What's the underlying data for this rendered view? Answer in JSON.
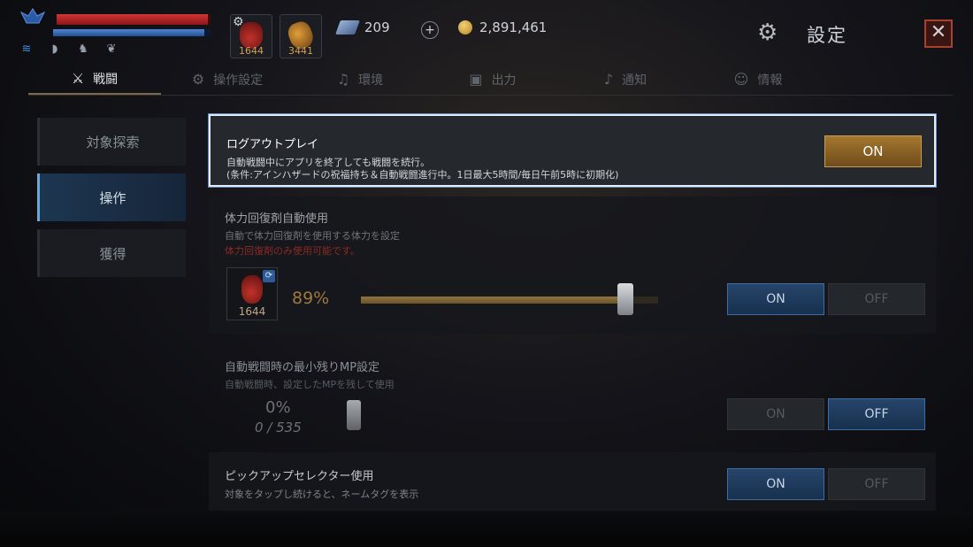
{
  "hud": {
    "hp_fraction": 0.98,
    "mp_fraction": 0.96,
    "status_icons": [
      "buff-icon",
      "helmet-icon",
      "mount-icon",
      "pet-icon"
    ],
    "slot1_qty": "1644",
    "slot2_qty": "3441",
    "gems": "209",
    "gold": "2,891,461"
  },
  "header": {
    "title": "設定",
    "close_glyph": "✕"
  },
  "tabs": [
    {
      "label": "戦闘",
      "icon": "crossed-swords-icon",
      "active": true
    },
    {
      "label": "操作設定",
      "icon": "gear-icon",
      "active": false
    },
    {
      "label": "環境",
      "icon": "music-note-icon",
      "active": false
    },
    {
      "label": "出力",
      "icon": "output-icon",
      "active": false
    },
    {
      "label": "通知",
      "icon": "bell-icon",
      "active": false
    },
    {
      "label": "情報",
      "icon": "person-icon",
      "active": false
    }
  ],
  "sidebar": {
    "items": [
      {
        "label": "対象探索",
        "active": false
      },
      {
        "label": "操作",
        "active": true
      },
      {
        "label": "獲得",
        "active": false
      }
    ]
  },
  "logout_play": {
    "title": "ログアウトプレイ",
    "desc1": "自動戦闘中にアプリを終了しても戦闘を続行。",
    "desc2": "(条件:アインハザードの祝福持ち＆自動戦闘進行中。1日最大5時間/毎日午前5時に初期化)",
    "button": "ON"
  },
  "hp_potion": {
    "title": "体力回復剤自動使用",
    "desc": "自動で体力回復剤を使用する体力を設定",
    "warning": "体力回復剤のみ使用可能です。",
    "qty": "1644",
    "percent_label": "89%",
    "percent_value": 0.89,
    "on_label": "ON",
    "off_label": "OFF",
    "state": "on"
  },
  "min_mp": {
    "title": "自動戦闘時の最小残りMP設定",
    "desc": "自動戦闘時、設定したMPを残して使用",
    "percent_label": "0%",
    "count_label": "0 / 535",
    "on_label": "ON",
    "off_label": "OFF",
    "state": "off"
  },
  "pickup_selector": {
    "title": "ピックアップセレクター使用",
    "desc": "対象をタップし続けると、ネームタグを表示",
    "on_label": "ON",
    "off_label": "OFF",
    "state": "on"
  },
  "colors": {
    "accent_gold": "#a3772f",
    "accent_blue": "#3e6da4",
    "hp_red": "#d23636",
    "mp_blue": "#4d86d6"
  }
}
